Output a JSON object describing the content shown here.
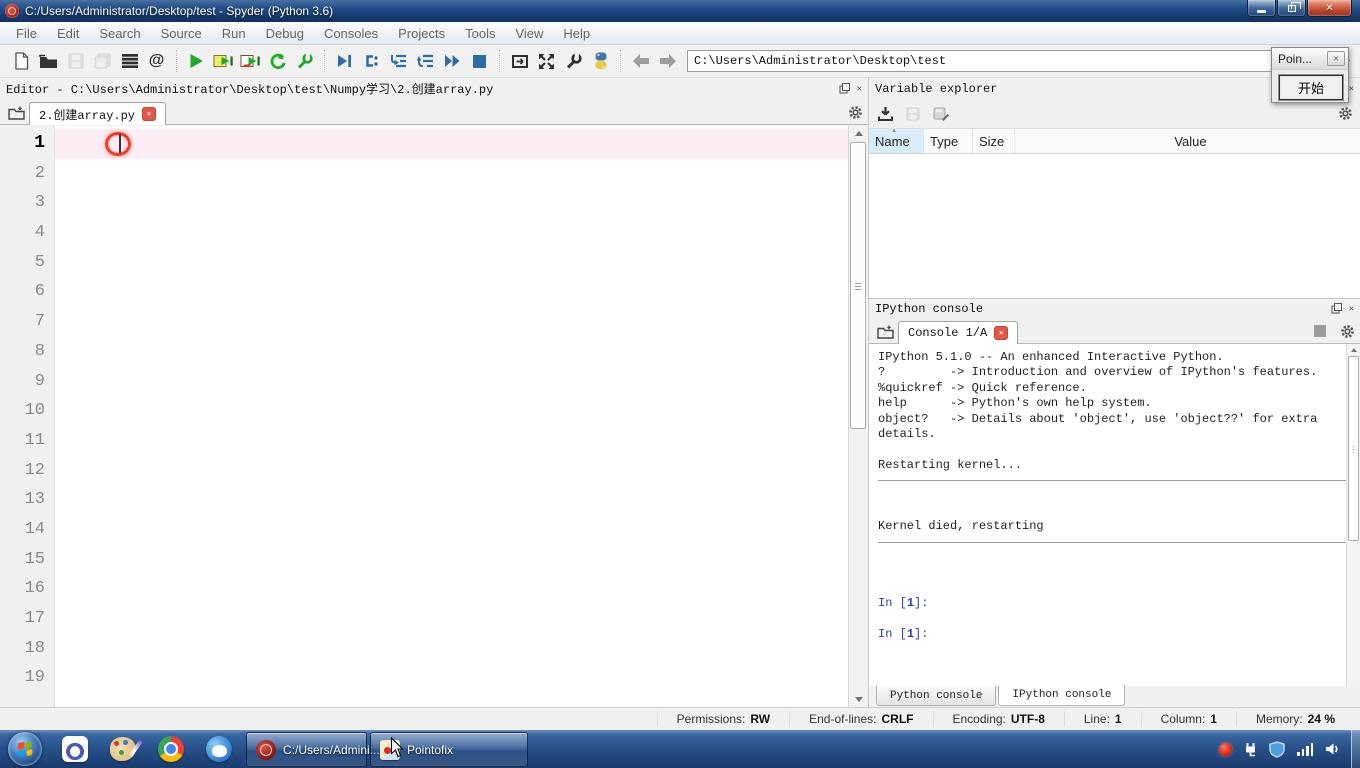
{
  "window": {
    "title": "C:/Users/Administrator/Desktop/test - Spyder (Python 3.6)"
  },
  "menu": {
    "items": [
      "File",
      "Edit",
      "Search",
      "Source",
      "Run",
      "Debug",
      "Consoles",
      "Projects",
      "Tools",
      "View",
      "Help"
    ]
  },
  "toolbar": {
    "path": "C:\\Users\\Administrator\\Desktop\\test"
  },
  "popup": {
    "title": "Poin...",
    "start_button": "开始"
  },
  "editor": {
    "header": "Editor - C:\\Users\\Administrator\\Desktop\\test\\Numpy学习\\2.创建array.py",
    "tab": "2.创建array.py",
    "current_line": 1,
    "line_numbers": [
      "1",
      "2",
      "3",
      "4",
      "5",
      "6",
      "7",
      "8",
      "9",
      "10",
      "11",
      "12",
      "13",
      "14",
      "15",
      "16",
      "17",
      "18",
      "19"
    ]
  },
  "variable_explorer": {
    "title": "Variable explorer",
    "columns": [
      "Name",
      "Type",
      "Size",
      "Value"
    ]
  },
  "ipython_console": {
    "title": "IPython console",
    "tab": "Console 1/A",
    "lines": [
      {
        "t": "text",
        "s": "IPython 5.1.0 -- An enhanced Interactive Python."
      },
      {
        "t": "text",
        "s": "?         -> Introduction and overview of IPython's features."
      },
      {
        "t": "text",
        "s": "%quickref -> Quick reference."
      },
      {
        "t": "text",
        "s": "help      -> Python's own help system."
      },
      {
        "t": "text",
        "s": "object?   -> Details about 'object', use 'object??' for extra"
      },
      {
        "t": "text",
        "s": "details."
      },
      {
        "t": "blank"
      },
      {
        "t": "text",
        "s": "Restarting kernel..."
      },
      {
        "t": "hr"
      },
      {
        "t": "blank"
      },
      {
        "t": "blank"
      },
      {
        "t": "text",
        "s": "Kernel died, restarting"
      },
      {
        "t": "hr"
      },
      {
        "t": "blank"
      },
      {
        "t": "blank"
      },
      {
        "t": "blank"
      },
      {
        "t": "prompt",
        "s": "In [",
        "n": "1",
        "e": "]:"
      },
      {
        "t": "blank"
      },
      {
        "t": "prompt",
        "s": "In [",
        "n": "1",
        "e": "]:"
      }
    ]
  },
  "console_tabs": {
    "python": "Python console",
    "ipython": "IPython console"
  },
  "statusbar": {
    "items": [
      {
        "label": "Permissions:",
        "value": "RW"
      },
      {
        "label": "End-of-lines:",
        "value": "CRLF"
      },
      {
        "label": "Encoding:",
        "value": "UTF-8"
      },
      {
        "label": "Line:",
        "value": "1"
      },
      {
        "label": "Column:",
        "value": "1"
      },
      {
        "label": "Memory:",
        "value": "24 %"
      }
    ]
  },
  "taskbar": {
    "buttons": [
      {
        "label": "C:/Users/Admini..."
      },
      {
        "label": "Pointofix"
      }
    ]
  },
  "icons": {
    "close": "✕",
    "float": "⧉",
    "at": "@",
    "sort": "▲"
  }
}
